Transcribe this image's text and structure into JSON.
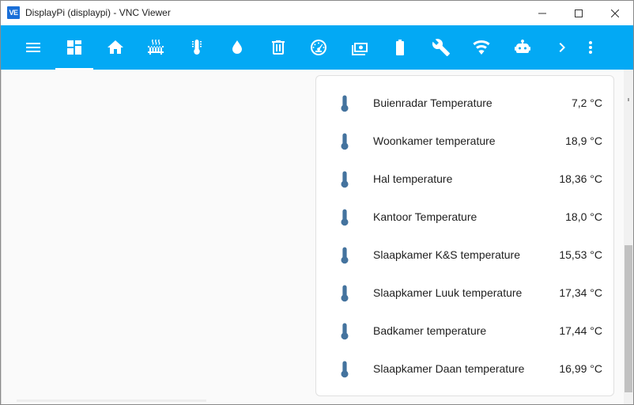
{
  "window": {
    "title": "DisplayPi (displaypi) - VNC Viewer",
    "app_icon_text": "VE",
    "controls": [
      "minimize-icon",
      "maximize-icon",
      "close-icon"
    ]
  },
  "toolbar": {
    "background": "#03a9f4",
    "icon_color": "#ffffff",
    "active_index": 1,
    "items": [
      {
        "icon": "menu-icon"
      },
      {
        "icon": "dashboard-icon"
      },
      {
        "icon": "home-icon"
      },
      {
        "icon": "radiator-icon"
      },
      {
        "icon": "thermometer-icon"
      },
      {
        "icon": "water-drop-icon"
      },
      {
        "icon": "trash-can-icon"
      },
      {
        "icon": "gauge-icon"
      },
      {
        "icon": "cash-icon"
      },
      {
        "icon": "battery-icon"
      },
      {
        "icon": "wrench-icon"
      },
      {
        "icon": "wifi-icon"
      },
      {
        "icon": "robot-icon"
      },
      {
        "icon": "chevron-right-icon"
      },
      {
        "icon": "more-vertical-icon"
      }
    ]
  },
  "sensors": {
    "icon": "thermometer-icon",
    "icon_color": "#44739e",
    "items": [
      {
        "name": "Buienradar Temperature",
        "value": "7,2 °C"
      },
      {
        "name": "Woonkamer temperature",
        "value": "18,9 °C"
      },
      {
        "name": "Hal temperature",
        "value": "18,36 °C"
      },
      {
        "name": "Kantoor Temperature",
        "value": "18,0 °C"
      },
      {
        "name": "Slaapkamer K&S temperature",
        "value": "15,53 °C"
      },
      {
        "name": "Slaapkamer Luuk temperature",
        "value": "17,34 °C"
      },
      {
        "name": "Badkamer temperature",
        "value": "17,44 °C"
      },
      {
        "name": "Slaapkamer Daan temperature",
        "value": "16,99 °C"
      }
    ]
  }
}
